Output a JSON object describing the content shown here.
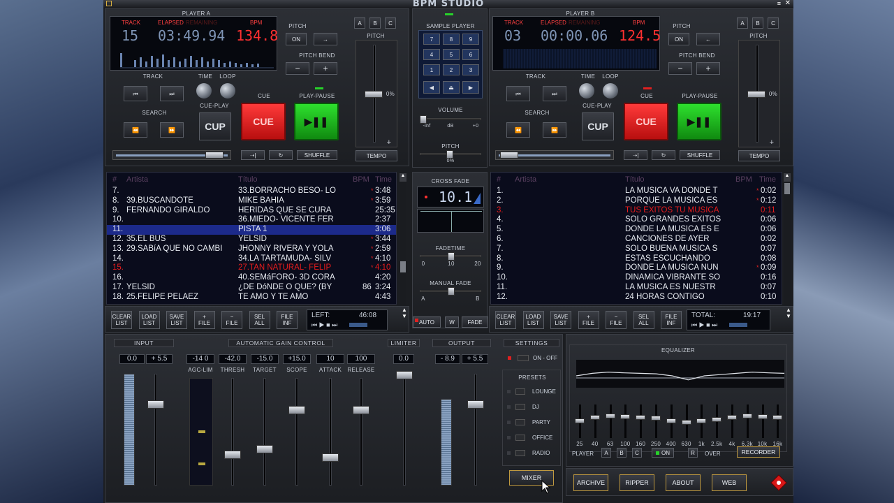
{
  "app": {
    "title": "BPM STUDIO"
  },
  "playerA": {
    "label": "PLAYER A",
    "track_label": "TRACK",
    "elapsed_label": "ELAPSED",
    "remain_label": "REMAINING",
    "bpm_label": "BPM",
    "track": "15",
    "time": "03:49.94",
    "bpm": "134.8",
    "pitch": {
      "label": "PITCH",
      "on": "ON",
      "arrow": "→",
      "bend_label": "PITCH BEND",
      "minus": "−",
      "plus": "+"
    },
    "abc": [
      "A",
      "B",
      "C"
    ],
    "fader_label": "PITCH",
    "fader_pct": "0%",
    "fader_plus": "+",
    "track_nav_label": "TRACK",
    "time_label": "TIME",
    "loop_label": "LOOP",
    "cue_label": "CUE",
    "cueplay_label": "CUE-PLAY",
    "playpause_label": "PLAY-PAUSE",
    "search_label": "SEARCH",
    "cup": "CUP",
    "cue": "CUE",
    "shuffle": "SHUFFLE",
    "tempo": "TEMPO"
  },
  "playerB": {
    "label": "PLAYER B",
    "track_label": "TRACK",
    "elapsed_label": "ELAPSED",
    "remain_label": "REMAINING",
    "bpm_label": "BPM",
    "track": "03",
    "time": "00:00.06",
    "bpm": "124.5",
    "pitch": {
      "label": "PITCH",
      "on": "ON",
      "arrow": "←",
      "bend_label": "PITCH BEND",
      "minus": "−",
      "plus": "+"
    },
    "abc": [
      "A",
      "B",
      "C"
    ],
    "fader_label": "PITCH",
    "fader_pct": "0%",
    "fader_plus": "+",
    "track_nav_label": "TRACK",
    "time_label": "TIME",
    "loop_label": "LOOP",
    "cue_label": "CUE",
    "cueplay_label": "CUE-PLAY",
    "playpause_label": "PLAY-PAUSE",
    "search_label": "SEARCH",
    "cup": "CUP",
    "cue": "CUE",
    "shuffle": "SHUFFLE",
    "tempo": "TEMPO"
  },
  "center": {
    "sample_player": "SAMPLE PLAYER",
    "keypad": [
      "7",
      "8",
      "9",
      "4",
      "5",
      "6",
      "1",
      "2",
      "3"
    ],
    "volume": "VOLUME",
    "vol_inf": "-inf",
    "vol_db": "dB",
    "vol_plus": "+0",
    "pitch": "PITCH",
    "pitch_pct": "0%",
    "crossfade": "CROSS FADE",
    "crossfade_value": "10.1",
    "fadetime": "FADETIME",
    "ft_min": "0",
    "ft_mid": "10",
    "ft_max": "20",
    "manual_fade": "MANUAL FADE",
    "mf_a": "A",
    "mf_b": "B",
    "auto": "AUTO",
    "w": "W",
    "fade": "FADE"
  },
  "listA": {
    "headers": {
      "num": "#",
      "artist": "Artista",
      "title": "Título",
      "bpm": "BPM",
      "time": "Time"
    },
    "rows": [
      {
        "n": "7.",
        "a": "",
        "t": "33.BORRACHO BESO- LO",
        "b": "",
        "tm": "3:48",
        "mark": "*",
        "style": "normal"
      },
      {
        "n": "8.",
        "a": "39.BUSCANDOTE",
        "t": "MIKE BAHIA",
        "b": "",
        "tm": "3:59",
        "mark": "*",
        "style": "normal"
      },
      {
        "n": "9.",
        "a": "FERNANDO GIRALDO",
        "t": "HERIDAS QUE SE CURA",
        "b": "",
        "tm": "25:35",
        "mark": "",
        "style": "normal"
      },
      {
        "n": "10.",
        "a": "",
        "t": "36.MIEDO- VICENTE FER",
        "b": "",
        "tm": "2:37",
        "mark": "",
        "style": "normal"
      },
      {
        "n": "11.",
        "a": "",
        "t": "PISTA 1",
        "b": "",
        "tm": "3:06",
        "mark": "",
        "style": "selected"
      },
      {
        "n": "12.",
        "a": "35.EL BUS",
        "t": "YELSID",
        "b": "",
        "tm": "3:44",
        "mark": "*",
        "style": "normal"
      },
      {
        "n": "13.",
        "a": "29.SABíA QUE NO CAMBI",
        "t": "JHONNY RIVERA Y YOLA",
        "b": "",
        "tm": "2:59",
        "mark": "*",
        "style": "normal"
      },
      {
        "n": "14.",
        "a": "",
        "t": "34.LA TARTAMUDA- SILV",
        "b": "",
        "tm": "4:10",
        "mark": "*",
        "style": "normal"
      },
      {
        "n": "15.",
        "a": "",
        "t": "27.TAN NATURAL- FELIP",
        "b": "",
        "tm": "4:10",
        "mark": "*",
        "style": "playing"
      },
      {
        "n": "16.",
        "a": "",
        "t": "40.SEMáFORO- 3D CORA",
        "b": "",
        "tm": "4:20",
        "mark": "",
        "style": "normal"
      },
      {
        "n": "17.",
        "a": "YELSID",
        "t": "¿DE DóNDE O QUE? (BY",
        "b": "86",
        "tm": "3:24",
        "mark": "",
        "style": "normal"
      },
      {
        "n": "18.",
        "a": "25.FELIPE PELAEZ",
        "t": "TE AMO Y TE AMO",
        "b": "",
        "tm": "4:43",
        "mark": "",
        "style": "normal"
      }
    ],
    "buttons": [
      {
        "l1": "CLEAR",
        "l2": "LIST"
      },
      {
        "l1": "LOAD",
        "l2": "LIST"
      },
      {
        "l1": "SAVE",
        "l2": "LIST"
      },
      {
        "l1": "+",
        "l2": "FILE"
      },
      {
        "l1": "−",
        "l2": "FILE"
      },
      {
        "l1": "SEL",
        "l2": "ALL"
      },
      {
        "l1": "FILE",
        "l2": "INF"
      }
    ],
    "status_label": "LEFT:",
    "status_value": "46:08"
  },
  "listB": {
    "headers": {
      "num": "#",
      "artist": "Artista",
      "title": "Título",
      "bpm": "BPM",
      "time": "Time"
    },
    "rows": [
      {
        "n": "1.",
        "t": "LA MUSICA VA DONDE T",
        "tm": "0:02",
        "mark": "*",
        "style": "normal"
      },
      {
        "n": "2.",
        "t": "PORQUE LA MUSICA ES",
        "tm": "0:12",
        "mark": "*",
        "style": "normal"
      },
      {
        "n": "3.",
        "t": "TUS EXITOS TU MUSICA",
        "tm": "0:11",
        "mark": "",
        "style": "playing"
      },
      {
        "n": "4.",
        "t": "SOLO GRANDES EXITOS",
        "tm": "0:06",
        "mark": "",
        "style": "normal"
      },
      {
        "n": "5.",
        "t": "DONDE LA MUSICA ES E",
        "tm": "0:06",
        "mark": "",
        "style": "normal"
      },
      {
        "n": "6.",
        "t": "CANCIONES DE AYER",
        "tm": "0:02",
        "mark": "",
        "style": "normal"
      },
      {
        "n": "7.",
        "t": "SOLO BUENA MUSICA S",
        "tm": "0:07",
        "mark": "",
        "style": "normal"
      },
      {
        "n": "8.",
        "t": "ESTAS ESCUCHANDO",
        "tm": "0:08",
        "mark": "",
        "style": "normal"
      },
      {
        "n": "9.",
        "t": "DONDE LA MUSICA NUN",
        "tm": "0:09",
        "mark": "*",
        "style": "normal"
      },
      {
        "n": "10.",
        "t": "DINAMICA VIBRANTE SO",
        "tm": "0:16",
        "mark": "",
        "style": "normal"
      },
      {
        "n": "11.",
        "t": "LA MUSICA ES NUESTR",
        "tm": "0:07",
        "mark": "",
        "style": "normal"
      },
      {
        "n": "12.",
        "t": "24 HORAS CONTIGO",
        "tm": "0:10",
        "mark": "",
        "style": "normal"
      }
    ],
    "buttons": [
      {
        "l1": "CLEAR",
        "l2": "LIST"
      },
      {
        "l1": "LOAD",
        "l2": "LIST"
      },
      {
        "l1": "SAVE",
        "l2": "LIST"
      },
      {
        "l1": "+",
        "l2": "FILE"
      },
      {
        "l1": "−",
        "l2": "FILE"
      },
      {
        "l1": "SEL",
        "l2": "ALL"
      },
      {
        "l1": "FILE",
        "l2": "INF"
      }
    ],
    "status_label": "TOTAL:",
    "status_value": "19:17"
  },
  "mixer": {
    "input": "INPUT",
    "in_l": "0.0",
    "in_r": "+ 5.5",
    "agc": "AUTOMATIC GAIN CONTROL",
    "agc_cols": [
      {
        "v": "-14  0",
        "l": "AGC-LIM"
      },
      {
        "v": "-42.0",
        "l": "THRESH"
      },
      {
        "v": "-15.0",
        "l": "TARGET"
      },
      {
        "v": "+15.0",
        "l": "SCOPE"
      },
      {
        "v": "10",
        "l": "ATTACK"
      },
      {
        "v": "100",
        "l": "RELEASE"
      }
    ],
    "limiter": "LIMITER",
    "lim_v": "0.0",
    "output": "OUTPUT",
    "out_l": "- 8.9",
    "out_r": "+ 5.5",
    "settings": "SETTINGS",
    "onoff": "ON - OFF",
    "presets": "PRESETS",
    "preset_items": [
      "LOUNGE",
      "DJ",
      "PARTY",
      "OFFICE",
      "RADIO"
    ],
    "mixer_btn": "MIXER"
  },
  "equalizer": {
    "title": "EQUALIZER",
    "bands": [
      "25",
      "40",
      "63",
      "100",
      "160",
      "250",
      "400",
      "630",
      "1k",
      "2.5k",
      "4k",
      "6.3k",
      "10k",
      "16k"
    ],
    "levels": [
      0.5,
      0.6,
      0.65,
      0.62,
      0.6,
      0.58,
      0.5,
      0.45,
      0.5,
      0.55,
      0.6,
      0.65,
      0.62,
      0.6
    ],
    "player": "PLAYER",
    "p_a": "A",
    "p_b": "B",
    "p_c": "C",
    "on": "ON",
    "r": "R",
    "over": "OVER",
    "recorder": "RECORDER"
  },
  "bottom": {
    "buttons": [
      "ARCHIVE",
      "RIPPER",
      "ABOUT",
      "WEB"
    ]
  },
  "colors": {
    "accent_red": "#ff3030",
    "cue_red": "#e01818",
    "play_green": "#1db31d",
    "lcd_blue": "#7f95b6",
    "selected_row": "#1c2a8a"
  }
}
